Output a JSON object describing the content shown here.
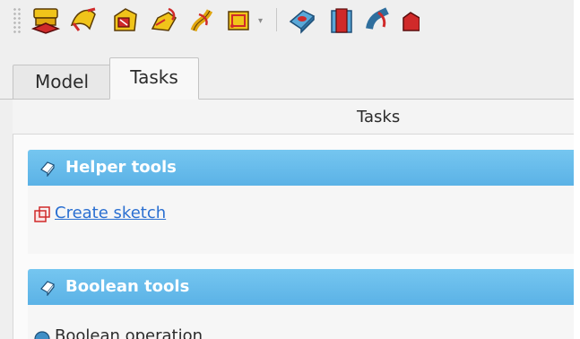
{
  "toolbar": {
    "icons": [
      "primitives-icon",
      "ruled-surface-icon",
      "loft-icon",
      "sweep-icon",
      "twist-icon",
      "cube-wireframe-icon",
      "shape-binder-icon",
      "extrude-cut-icon",
      "boolean-tool-icon",
      "shape-icon"
    ]
  },
  "tabs": [
    {
      "label": "Model",
      "active": false
    },
    {
      "label": "Tasks",
      "active": true
    }
  ],
  "panel": {
    "title": "Tasks",
    "sections": [
      {
        "title": "Helper tools",
        "icon": "tools-icon",
        "items": [
          {
            "label": "Create sketch",
            "icon": "sketch-icon",
            "link": true
          }
        ]
      },
      {
        "title": "Boolean tools",
        "icon": "tools-icon",
        "items": [
          {
            "label": "Boolean operation",
            "icon": "boolean-icon",
            "link": false
          }
        ]
      }
    ]
  },
  "colors": {
    "section_header": "#5bb2e6",
    "link": "#2a6fd1",
    "background": "#efefef"
  }
}
